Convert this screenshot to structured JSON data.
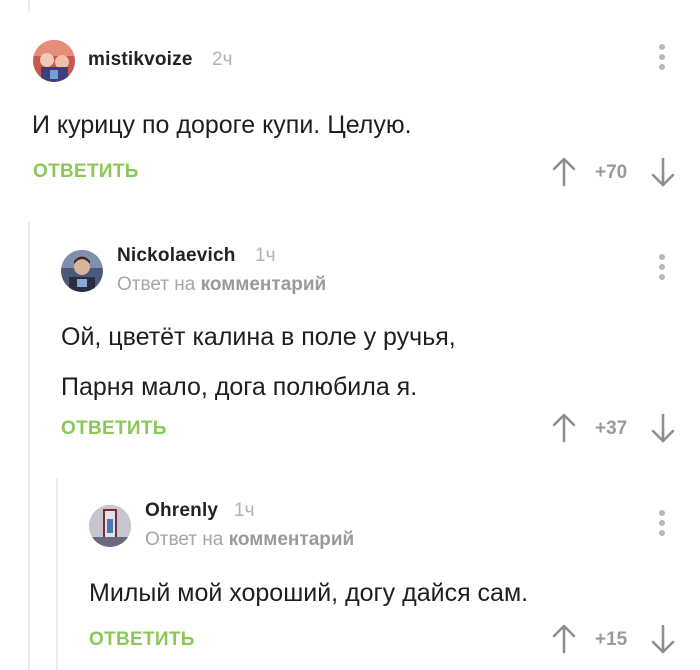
{
  "labels": {
    "reply_button": "ОТВЕТИТЬ",
    "reply_prefix": "Ответ на",
    "reply_target": "комментарий"
  },
  "comments": [
    {
      "username": "mistikvoize",
      "time": "2ч",
      "lines": [
        "И курицу по дороге купи. Целую."
      ],
      "rating": "+70"
    },
    {
      "username": "Nickolaevich",
      "time": "1ч",
      "lines": [
        "Ой, цветёт калина в поле у ручья,",
        "Парня мало, дога полюбила я."
      ],
      "rating": "+37"
    },
    {
      "username": "Ohrenly",
      "time": "1ч",
      "lines": [
        "Милый мой хороший, догу дайся сам."
      ],
      "rating": "+15"
    }
  ],
  "colors": {
    "accent_green": "#8ac858",
    "muted_gray": "#a6a6a6",
    "thread_line": "#ececec"
  }
}
